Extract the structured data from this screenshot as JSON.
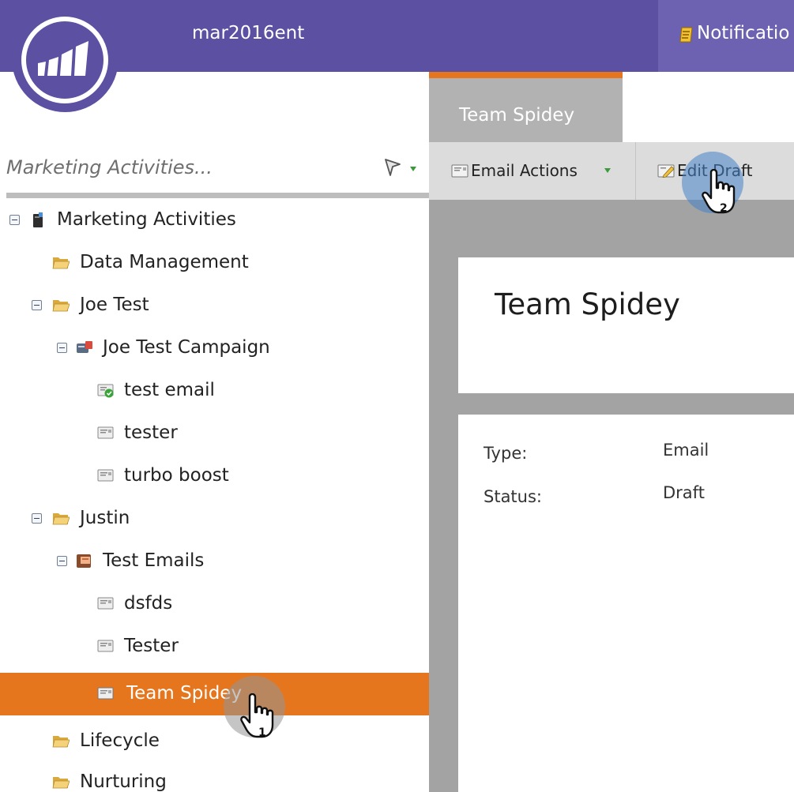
{
  "header": {
    "instance_name": "mar2016ent",
    "notifications_label": "Notificatio"
  },
  "sidebar": {
    "search_placeholder": "Marketing Activities...",
    "tree": [
      {
        "label": "Marketing Activities",
        "icon": "marketing-activities-icon",
        "expanded": true
      },
      {
        "label": "Data Management",
        "icon": "folder-icon"
      },
      {
        "label": "Joe Test",
        "icon": "folder-icon",
        "expanded": true
      },
      {
        "label": "Joe Test Campaign",
        "icon": "program-icon",
        "expanded": true
      },
      {
        "label": "test email",
        "icon": "email-approved-icon"
      },
      {
        "label": "tester",
        "icon": "email-icon"
      },
      {
        "label": "turbo boost",
        "icon": "email-icon"
      },
      {
        "label": "Justin",
        "icon": "folder-icon",
        "expanded": true
      },
      {
        "label": "Test Emails",
        "icon": "email-program-icon",
        "expanded": true
      },
      {
        "label": "dsfds",
        "icon": "email-icon"
      },
      {
        "label": "Tester",
        "icon": "email-icon"
      },
      {
        "label": "Team Spidey",
        "icon": "email-icon",
        "selected": true
      },
      {
        "label": "Lifecycle",
        "icon": "folder-icon"
      },
      {
        "label": "Nurturing",
        "icon": "folder-icon"
      }
    ]
  },
  "main": {
    "tab_label": "Team Spidey",
    "toolbar": {
      "email_actions_label": "Email Actions",
      "edit_draft_label": "Edit Draft"
    },
    "title": "Team Spidey",
    "details": {
      "type_label": "Type:",
      "type_value": "Email",
      "status_label": "Status:",
      "status_value": "Draft"
    }
  },
  "annotations": {
    "step_1": "1",
    "step_2": "2"
  },
  "colors": {
    "brand_purple": "#5b50a2",
    "accent_orange": "#e5761d"
  }
}
